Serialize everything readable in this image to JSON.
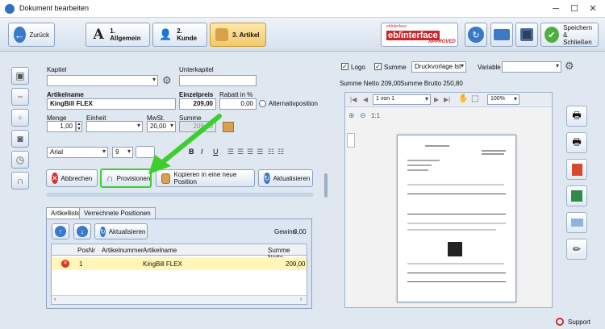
{
  "window": {
    "title": "Dokument bearbeiten"
  },
  "toolbar": {
    "back_label": "Zurück",
    "tab1_label": "1. Allgemein",
    "tab2_label": "2. Kunde",
    "tab3_label": "3. Artikel",
    "ebi_small": "ebInterface",
    "ebi_main": "eb/interface",
    "ebi_approved": "APPROVED",
    "save_label_line1": "Speichern",
    "save_label_line2": "& Schließen"
  },
  "form": {
    "kapitel_label": "Kapitel",
    "unterkapitel_label": "Unterkapitel",
    "artikelname_label": "Artikelname",
    "artikelname_value": "KingBill FLEX",
    "einzelpreis_label": "Einzelpreis",
    "einzelpreis_value": "209,00",
    "rabatt_label": "Rabatt in %",
    "rabatt_value": "0,00",
    "alternativ_label": "Alternativposition",
    "menge_label": "Menge",
    "menge_value": "1,00",
    "einheit_label": "Einheit",
    "mwst_label": "MwSt.",
    "mwst_value": "20,00",
    "summe_label": "Summe",
    "summe_value": "209,00",
    "font_name": "Arial",
    "font_size": "9"
  },
  "actions": {
    "abbrechen": "Abbrechen",
    "provisionen": "Provisionen",
    "kopieren": "Kopieren in eine neue Position",
    "aktualisieren": "Aktualisieren"
  },
  "tabs": {
    "artikelliste": "Artikelliste",
    "verrechnete": "Verrechnete Positionen"
  },
  "list": {
    "refresh_label": "Aktualisieren",
    "gewinn_label": "Gewinn",
    "gewinn_value": "0,00",
    "columns": [
      "PosNr",
      "Artikelnummer",
      "Artikelname",
      "Summe Netto"
    ],
    "rows": [
      {
        "posnr": "1",
        "artikelnummer": "",
        "artikelname": "KingBill FLEX",
        "summe": "209,00"
      }
    ]
  },
  "preview_options": {
    "logo_label": "Logo",
    "summe_label": "Summe",
    "druckvorlage": "Druckvorlage lst",
    "variable_label": "Variable",
    "summe_netto": "Summe Netto  209,00",
    "summe_brutto": "Summe Brutto  250,80",
    "page_label": "1 von 1",
    "zoom": "100%",
    "zoom_ratio": "1:1"
  },
  "footer": {
    "support_label": "Support"
  },
  "colors": {
    "accent_yellow": "#f2c86a",
    "selected_row": "#fff6b8",
    "arrow_green": "#3ccf2c",
    "red_cancel": "#d9352b"
  }
}
